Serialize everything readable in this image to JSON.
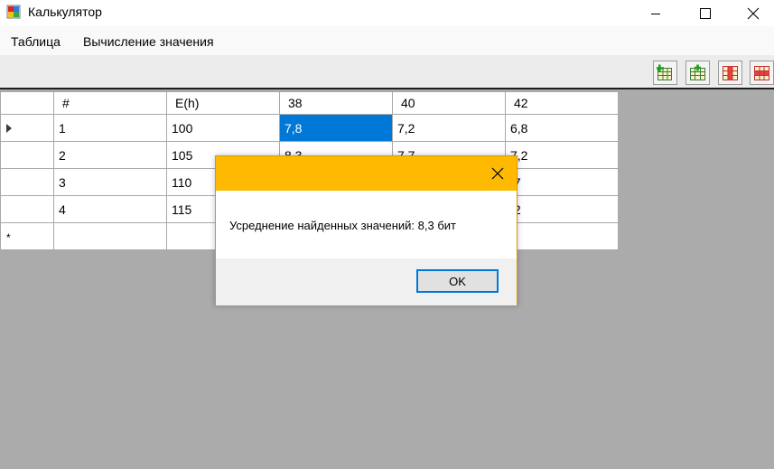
{
  "window": {
    "title": "Калькулятор",
    "icon": "app-grid-icon",
    "controls": [
      "minimize-icon",
      "maximize-icon",
      "close-icon"
    ]
  },
  "menu": {
    "items": [
      "Таблица",
      "Вычисление значения"
    ]
  },
  "toolbar": {
    "buttons": [
      "add-row-icon",
      "add-column-icon",
      "delete-column-icon",
      "delete-row-icon"
    ]
  },
  "grid": {
    "columns": [
      "#",
      "E(h)",
      "38",
      "40",
      "42"
    ],
    "rows": [
      [
        "1",
        "100",
        "7,8",
        "7,2",
        "6,8"
      ],
      [
        "2",
        "105",
        "8,3",
        "7,7",
        "7,2"
      ],
      [
        "3",
        "110",
        "",
        "",
        ",7"
      ],
      [
        "4",
        "115",
        "",
        "",
        ",2"
      ]
    ],
    "current_row_marker": "▶",
    "new_row_marker": "*"
  },
  "dialog": {
    "title": "",
    "message": "Усреднение найденных значений: 8,3 бит",
    "ok_label": "OK",
    "accent_color": "#ffb900"
  },
  "colors": {
    "selection": "#0078d7",
    "workspace": "#ababab"
  }
}
